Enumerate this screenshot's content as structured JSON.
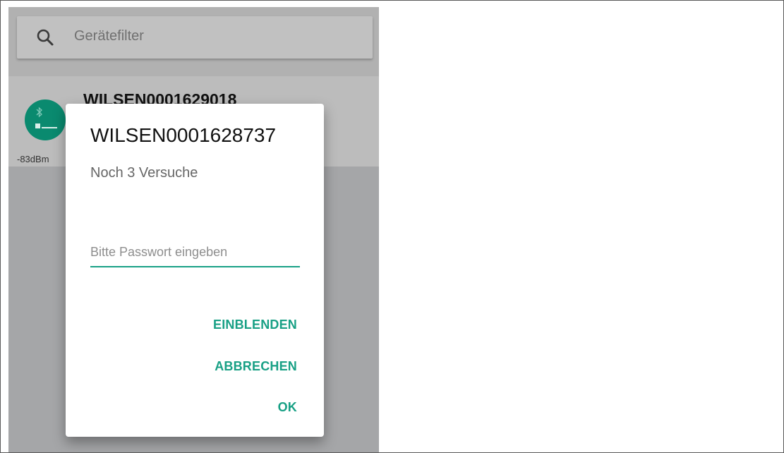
{
  "search": {
    "placeholder": "Gerätefilter",
    "icon": "search-icon"
  },
  "device": {
    "name": "WILSEN0001629018",
    "rssi": "-83dBm",
    "icon": "bluetooth-icon"
  },
  "dialog": {
    "title": "WILSEN0001628737",
    "subtitle": "Noch 3 Versuche",
    "password": {
      "value": "",
      "placeholder": "Bitte Passwort eingeben"
    },
    "buttons": {
      "show": "EINBLENDEN",
      "cancel": "ABBRECHEN",
      "ok": "OK"
    }
  },
  "colors": {
    "accent": "#18a085",
    "avatar": "#0a8a6f",
    "overlay": "#a5a6a8"
  }
}
